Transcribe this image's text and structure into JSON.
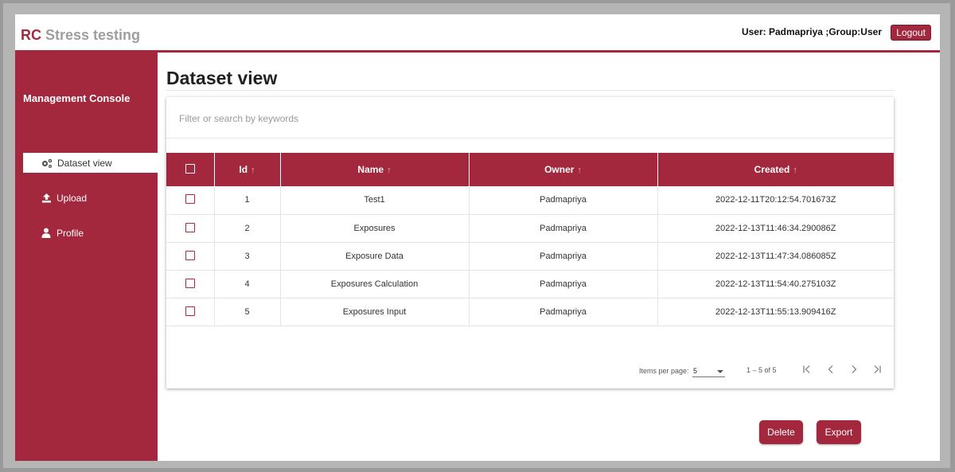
{
  "header": {
    "brand_prefix": "RC",
    "brand_suffix": " Stress testing",
    "user_info": "User: Padmapriya ;Group:User",
    "logout_label": "Logout"
  },
  "sidebar": {
    "title": "Management Console",
    "items": [
      {
        "label": "Dataset view",
        "icon": "gears-icon",
        "active": true
      },
      {
        "label": "Upload",
        "icon": "upload-icon",
        "active": false
      },
      {
        "label": "Profile",
        "icon": "user-icon",
        "active": false
      }
    ]
  },
  "main": {
    "title": "Dataset view",
    "search_placeholder": "Filter or search by keywords",
    "columns": [
      "Id",
      "Name",
      "Owner",
      "Created"
    ],
    "sort_arrow": "↑",
    "rows": [
      {
        "id": "1",
        "name": "Test1",
        "owner": "Padmapriya",
        "created": "2022-12-11T20:12:54.701673Z"
      },
      {
        "id": "2",
        "name": "Exposures",
        "owner": "Padmapriya",
        "created": "2022-12-13T11:46:34.290086Z"
      },
      {
        "id": "3",
        "name": "Exposure Data",
        "owner": "Padmapriya",
        "created": "2022-12-13T11:47:34.086085Z"
      },
      {
        "id": "4",
        "name": "Exposures Calculation",
        "owner": "Padmapriya",
        "created": "2022-12-13T11:54:40.275103Z"
      },
      {
        "id": "5",
        "name": "Exposures Input",
        "owner": "Padmapriya",
        "created": "2022-12-13T11:55:13.909416Z"
      }
    ],
    "paginator": {
      "items_per_page_label": "Items per page:",
      "items_per_page_value": "5",
      "range_label": "1 – 5 of 5"
    },
    "delete_label": "Delete",
    "export_label": "Export"
  },
  "colors": {
    "accent": "#a3273d",
    "header_text": "#ffffff",
    "brand_gray": "#9e9e9e"
  }
}
